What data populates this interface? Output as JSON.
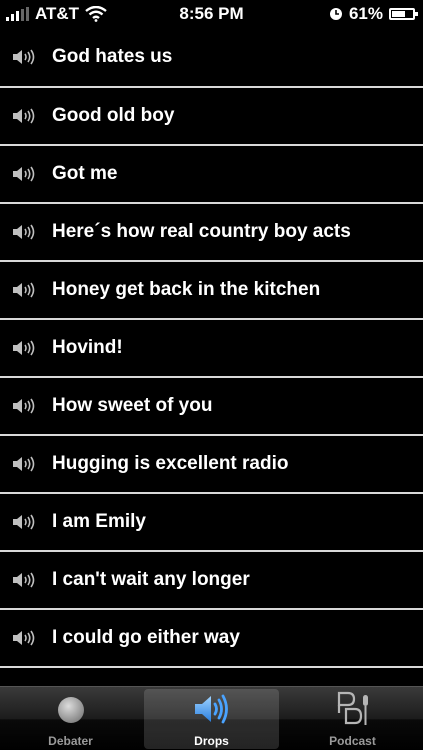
{
  "status_bar": {
    "carrier": "AT&T",
    "time": "8:56 PM",
    "battery": "61%",
    "battery_level": 0.61
  },
  "list": {
    "items": [
      {
        "label": "God hates us"
      },
      {
        "label": "Good old boy"
      },
      {
        "label": "Got me"
      },
      {
        "label": "Here´s how real country boy acts"
      },
      {
        "label": "Honey get back in the kitchen"
      },
      {
        "label": "Hovind!"
      },
      {
        "label": "How sweet of you"
      },
      {
        "label": "Hugging is excellent radio"
      },
      {
        "label": "I am Emily"
      },
      {
        "label": "I can't wait any longer"
      },
      {
        "label": "I could go either way"
      }
    ]
  },
  "tab_bar": {
    "tabs": [
      {
        "label": "Debater",
        "icon": "debater-ball-icon",
        "active": false
      },
      {
        "label": "Drops",
        "icon": "speaker-icon",
        "active": true
      },
      {
        "label": "Podcast",
        "icon": "podcast-logo-icon",
        "active": false
      }
    ]
  },
  "colors": {
    "background": "#000000",
    "separator": "#d9d9d9",
    "active_icon": "#4aa3ff"
  }
}
